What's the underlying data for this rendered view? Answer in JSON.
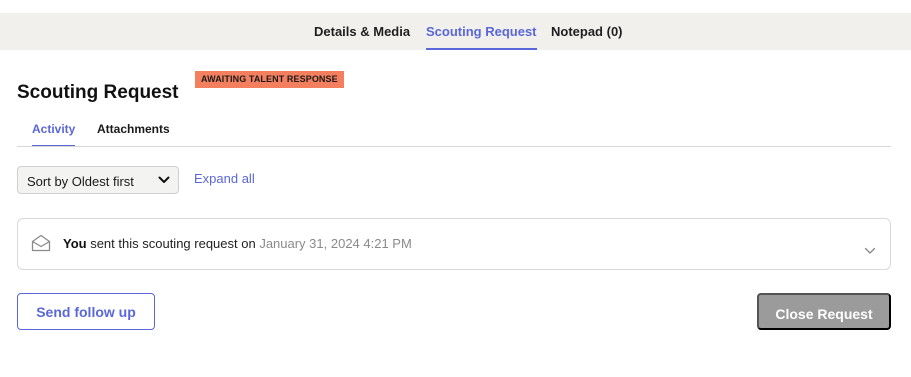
{
  "tabs": {
    "details_media": "Details & Media",
    "scouting_request": "Scouting Request",
    "notepad": "Notepad (0)",
    "active": "scouting_request"
  },
  "header": {
    "title": "Scouting Request",
    "status_badge": "AWAITING TALENT RESPONSE"
  },
  "subtabs": {
    "activity": "Activity",
    "attachments": "Attachments",
    "active": "activity"
  },
  "controls": {
    "sort_label": "Sort by Oldest first",
    "expand_all": "Expand all"
  },
  "activity": [
    {
      "actor": "You",
      "action": " sent this scouting request on ",
      "timestamp": "January 31, 2024 4:21 PM",
      "icon": "envelope-open-icon"
    }
  ],
  "actions": {
    "send_follow_up": "Send follow up",
    "close_request": "Close Request"
  },
  "colors": {
    "accent": "#5a67d8",
    "badge": "#f47f5e",
    "tab_bar": "#f1f0ec",
    "disabled_button": "#9b9b9b"
  }
}
